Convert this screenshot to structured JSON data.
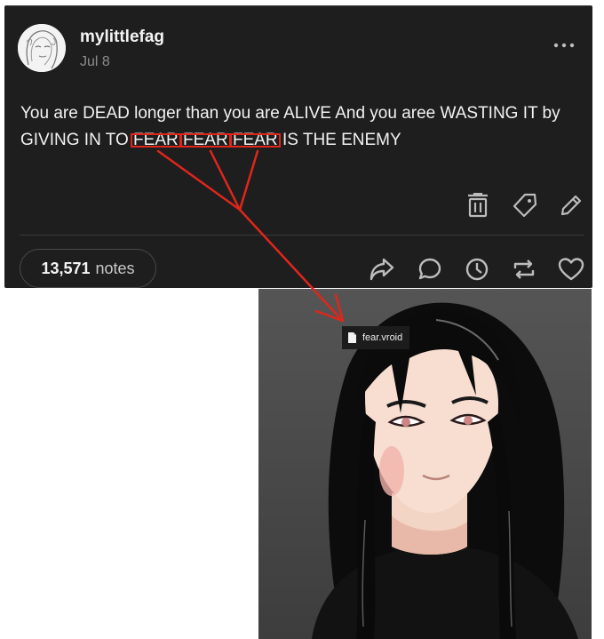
{
  "post": {
    "username": "mylittlefag",
    "date": "Jul 8",
    "text": {
      "line1": "You are DEAD longer than you are ALIVE And you aree WASTING IT by",
      "line2_prefix": "GIVING IN TO ",
      "fear_words": [
        "FEAR",
        "FEAR",
        "FEAR"
      ],
      "line2_suffix": " IS THE ENEMY"
    },
    "notes": {
      "count": "13,571",
      "label": "notes"
    },
    "icons": {
      "more": "more-options-icon",
      "delete": "trash-icon",
      "tag": "tag-icon",
      "edit": "pencil-icon",
      "share": "share-icon",
      "reply": "comment-icon",
      "history": "clock-icon",
      "reblog": "reblog-icon",
      "like": "heart-icon"
    }
  },
  "render_image": {
    "file_name": "fear.vroid"
  },
  "colors": {
    "post_background": "#1e1e1f",
    "annotation_red": "#e0261b"
  }
}
